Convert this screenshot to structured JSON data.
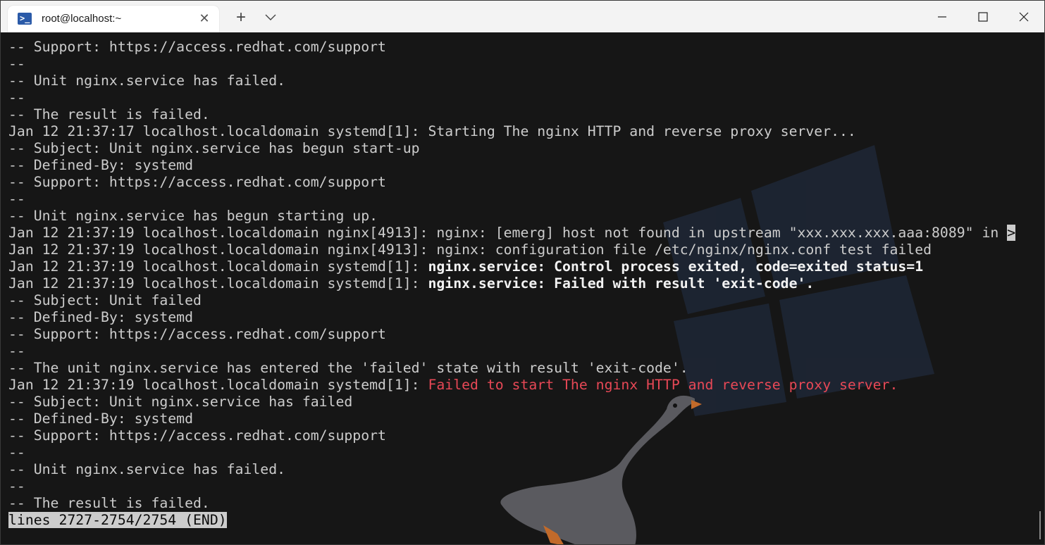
{
  "window": {
    "tab_title": "root@localhost:~",
    "tab_icon": "powershell-icon",
    "new_tab_symbol": "+",
    "dropdown_symbol": "⌵",
    "close_tab_symbol": "✕"
  },
  "terminal": {
    "lines": [
      [
        {
          "t": "-- Support: https://access.redhat.com/support"
        }
      ],
      [
        {
          "t": "--"
        }
      ],
      [
        {
          "t": "-- Unit nginx.service has failed."
        }
      ],
      [
        {
          "t": "--"
        }
      ],
      [
        {
          "t": "-- The result is failed."
        }
      ],
      [
        {
          "t": "Jan 12 21:37:17 localhost.localdomain systemd[1]: Starting The nginx HTTP and reverse proxy server..."
        }
      ],
      [
        {
          "t": "-- Subject: Unit nginx.service has begun start-up"
        }
      ],
      [
        {
          "t": "-- Defined-By: systemd"
        }
      ],
      [
        {
          "t": "-- Support: https://access.redhat.com/support"
        }
      ],
      [
        {
          "t": "--"
        }
      ],
      [
        {
          "t": "-- Unit nginx.service has begun starting up."
        }
      ],
      [
        {
          "t": "Jan 12 21:37:19 localhost.localdomain nginx[4913]: nginx: [emerg] host not found in upstream \"xxx.xxx.xxx.aaa:8089\" in "
        },
        {
          "t": ">",
          "s": "cursor-block"
        }
      ],
      [
        {
          "t": "Jan 12 21:37:19 localhost.localdomain nginx[4913]: nginx: configuration file /etc/nginx/nginx.conf test failed"
        }
      ],
      [
        {
          "t": "Jan 12 21:37:19 localhost.localdomain systemd[1]: "
        },
        {
          "t": "nginx.service: Control process exited, code=exited status=1",
          "s": "bold"
        }
      ],
      [
        {
          "t": "Jan 12 21:37:19 localhost.localdomain systemd[1]: "
        },
        {
          "t": "nginx.service: Failed with result 'exit-code'.",
          "s": "bold"
        }
      ],
      [
        {
          "t": "-- Subject: Unit failed"
        }
      ],
      [
        {
          "t": "-- Defined-By: systemd"
        }
      ],
      [
        {
          "t": "-- Support: https://access.redhat.com/support"
        }
      ],
      [
        {
          "t": "--"
        }
      ],
      [
        {
          "t": "-- The unit nginx.service has entered the 'failed' state with result 'exit-code'."
        }
      ],
      [
        {
          "t": "Jan 12 21:37:19 localhost.localdomain systemd[1]: "
        },
        {
          "t": "Failed to start The nginx HTTP and reverse proxy server.",
          "s": "red"
        }
      ],
      [
        {
          "t": "-- Subject: Unit nginx.service has failed"
        }
      ],
      [
        {
          "t": "-- Defined-By: systemd"
        }
      ],
      [
        {
          "t": "-- Support: https://access.redhat.com/support"
        }
      ],
      [
        {
          "t": "--"
        }
      ],
      [
        {
          "t": "-- Unit nginx.service has failed."
        }
      ],
      [
        {
          "t": "--"
        }
      ],
      [
        {
          "t": "-- The result is failed."
        }
      ]
    ],
    "status_line": "lines 2727-2754/2754 (END)"
  }
}
